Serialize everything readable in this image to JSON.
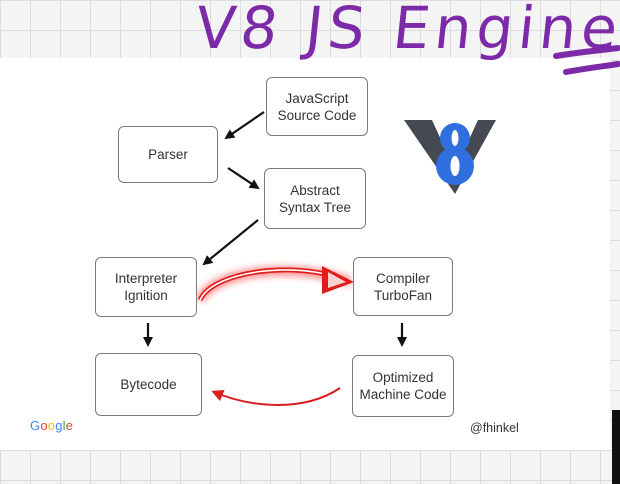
{
  "title": "V8 JS Engine",
  "nodes": {
    "js_source": [
      "JavaScript",
      "Source Code"
    ],
    "parser": [
      "Parser"
    ],
    "ast": [
      "Abstract",
      "Syntax Tree"
    ],
    "interpreter": [
      "Interpreter",
      "Ignition"
    ],
    "compiler": [
      "Compiler",
      "TurboFan"
    ],
    "bytecode": [
      "Bytecode"
    ],
    "optimized": [
      "Optimized",
      "Machine Code"
    ]
  },
  "footer": {
    "brand": [
      "G",
      "o",
      "o",
      "g",
      "l",
      "e"
    ],
    "brand_colors": [
      "#4285F4",
      "#EA4335",
      "#FBBC05",
      "#4285F4",
      "#34A853",
      "#EA4335"
    ],
    "handle": "@fhinkel"
  },
  "colors": {
    "title": "#7d2aa8",
    "logo_blue": "#2f6fe0",
    "logo_dark": "#454a52",
    "highlight_arrow": "#d81e1e"
  },
  "logo": "v8-logo-icon"
}
